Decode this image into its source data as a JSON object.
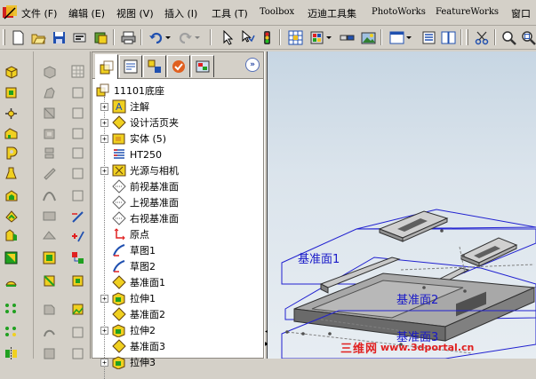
{
  "menubar": {
    "items": [
      {
        "label": "文件 (F)",
        "name": "menu-file"
      },
      {
        "label": "编辑 (E)",
        "name": "menu-edit"
      },
      {
        "label": "视图 (V)",
        "name": "menu-view"
      },
      {
        "label": "插入 (I)",
        "name": "menu-insert"
      },
      {
        "label": "工具 (T)",
        "name": "menu-tools"
      },
      {
        "label": "Toolbox",
        "name": "menu-toolbox"
      },
      {
        "label": "迈迪工具集",
        "name": "menu-maidi"
      },
      {
        "label": "PhotoWorks",
        "name": "menu-photoworks"
      },
      {
        "label": "FeatureWorks",
        "name": "menu-featureworks"
      },
      {
        "label": "窗口",
        "name": "menu-window"
      }
    ]
  },
  "feature_manager": {
    "root": "11101底座",
    "nodes": [
      {
        "label": "注解",
        "icon": "annotation-icon",
        "expandable": true
      },
      {
        "label": "设计活页夹",
        "icon": "design-binder-icon",
        "expandable": true
      },
      {
        "label": "实体 (5)",
        "icon": "solid-bodies-icon",
        "expandable": true
      },
      {
        "label": "HT250",
        "icon": "material-icon",
        "expandable": false
      },
      {
        "label": "光源与相机",
        "icon": "lights-camera-icon",
        "expandable": true
      },
      {
        "label": "前视基准面",
        "icon": "plane-icon",
        "expandable": false
      },
      {
        "label": "上视基准面",
        "icon": "plane-icon",
        "expandable": false
      },
      {
        "label": "右视基准面",
        "icon": "plane-icon",
        "expandable": false
      },
      {
        "label": "原点",
        "icon": "origin-icon",
        "expandable": false
      },
      {
        "label": "草图1",
        "icon": "sketch-icon",
        "expandable": false
      },
      {
        "label": "草图2",
        "icon": "sketch-icon",
        "expandable": false
      },
      {
        "label": "基准面1",
        "icon": "plane-icon",
        "expandable": false
      },
      {
        "label": "拉伸1",
        "icon": "extrude-icon",
        "expandable": true
      },
      {
        "label": "基准面2",
        "icon": "plane-icon",
        "expandable": false
      },
      {
        "label": "拉伸2",
        "icon": "extrude-icon",
        "expandable": true
      },
      {
        "label": "基准面3",
        "icon": "plane-icon",
        "expandable": false
      },
      {
        "label": "拉伸3",
        "icon": "extrude-icon",
        "expandable": true
      }
    ]
  },
  "viewport": {
    "plane_labels": [
      "基准面1",
      "基准面2",
      "基准面3"
    ]
  },
  "watermark": {
    "brand": "三维网",
    "url": "www.3dportal.cn"
  },
  "colors": {
    "plane_outline": "#2020d0",
    "part_gray": "#8a8a8a",
    "watermark": "#e02020"
  }
}
